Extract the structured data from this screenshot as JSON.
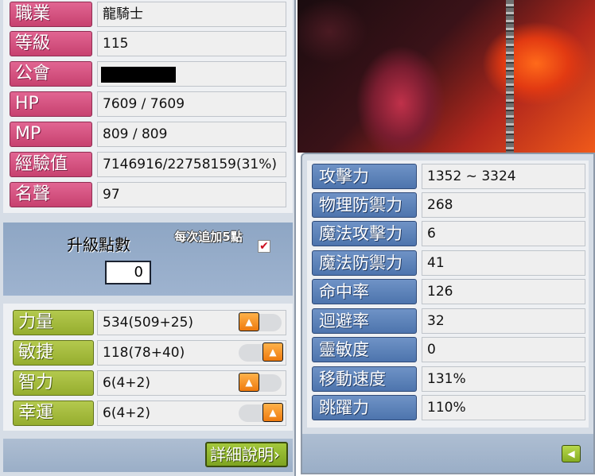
{
  "character_info": [
    {
      "label": "職業",
      "value": "龍騎士"
    },
    {
      "label": "等級",
      "value": "115"
    },
    {
      "label": "公會",
      "value": ""
    },
    {
      "label": "HP",
      "value": "7609 / 7609"
    },
    {
      "label": "MP",
      "value": "809 / 809"
    },
    {
      "label": "經驗值",
      "value": "7146916/22758159(31%)"
    },
    {
      "label": "名聲",
      "value": "97"
    }
  ],
  "ability_points": {
    "label": "升級點數",
    "value": "0"
  },
  "auto_assign": {
    "label": "每次追加5點",
    "checked": true
  },
  "base_stats": [
    {
      "label": "力量",
      "value": "534(509+25)"
    },
    {
      "label": "敏捷",
      "value": "118(78+40)"
    },
    {
      "label": "智力",
      "value": "6(4+2)"
    },
    {
      "label": "幸運",
      "value": "6(4+2)"
    }
  ],
  "details_button": {
    "label": "詳細說明"
  },
  "detailed_stats": [
    {
      "label": "攻擊力",
      "value": "1352 ~ 3324"
    },
    {
      "label": "物理防禦力",
      "value": "268"
    },
    {
      "label": "魔法攻擊力",
      "value": "6"
    },
    {
      "label": "魔法防禦力",
      "value": "41"
    },
    {
      "label": "命中率",
      "value": "126"
    },
    {
      "label": "迴避率",
      "value": "32"
    },
    {
      "label": "靈敏度",
      "value": "0"
    },
    {
      "label": "移動速度",
      "value": "131%"
    },
    {
      "label": "跳躍力",
      "value": "110%"
    }
  ],
  "icons": {
    "up_arrow": "up-arrow-icon",
    "checkmark": "checkmark-icon",
    "back": "back-arrow-icon"
  },
  "colors": {
    "info_label": "#d4527f",
    "stat_label": "#a6bc3c",
    "detail_label": "#5c82b9",
    "button_orange": "#f38a1c"
  }
}
